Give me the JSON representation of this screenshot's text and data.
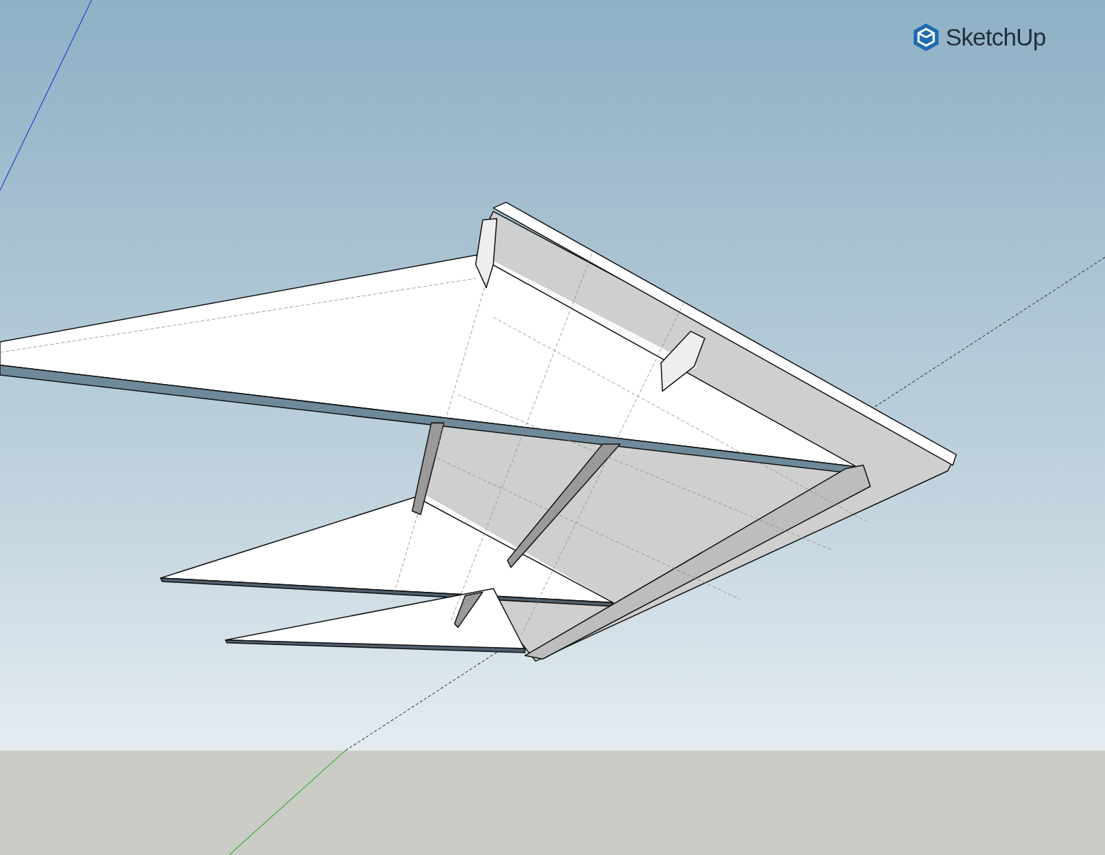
{
  "logo": {
    "text": "SketchUp"
  }
}
